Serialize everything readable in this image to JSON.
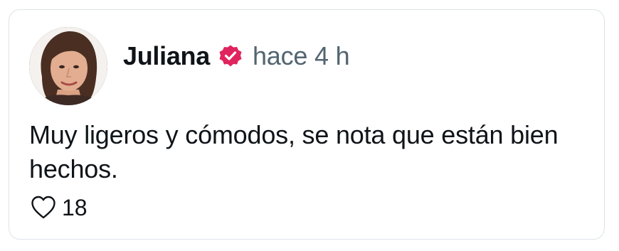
{
  "comment": {
    "author": "Juliana",
    "verified": true,
    "timestamp": "hace 4 h",
    "text": "Muy ligeros y cómodos, se nota que están bien hechos.",
    "like_count": "18",
    "icons": {
      "avatar": "avatar-photo",
      "verified": "verified-badge-icon",
      "like": "heart-icon"
    },
    "colors": {
      "verified_badge": "#e0245e",
      "text": "#0f1419",
      "muted": "#536471",
      "border": "#dde3e8"
    }
  }
}
